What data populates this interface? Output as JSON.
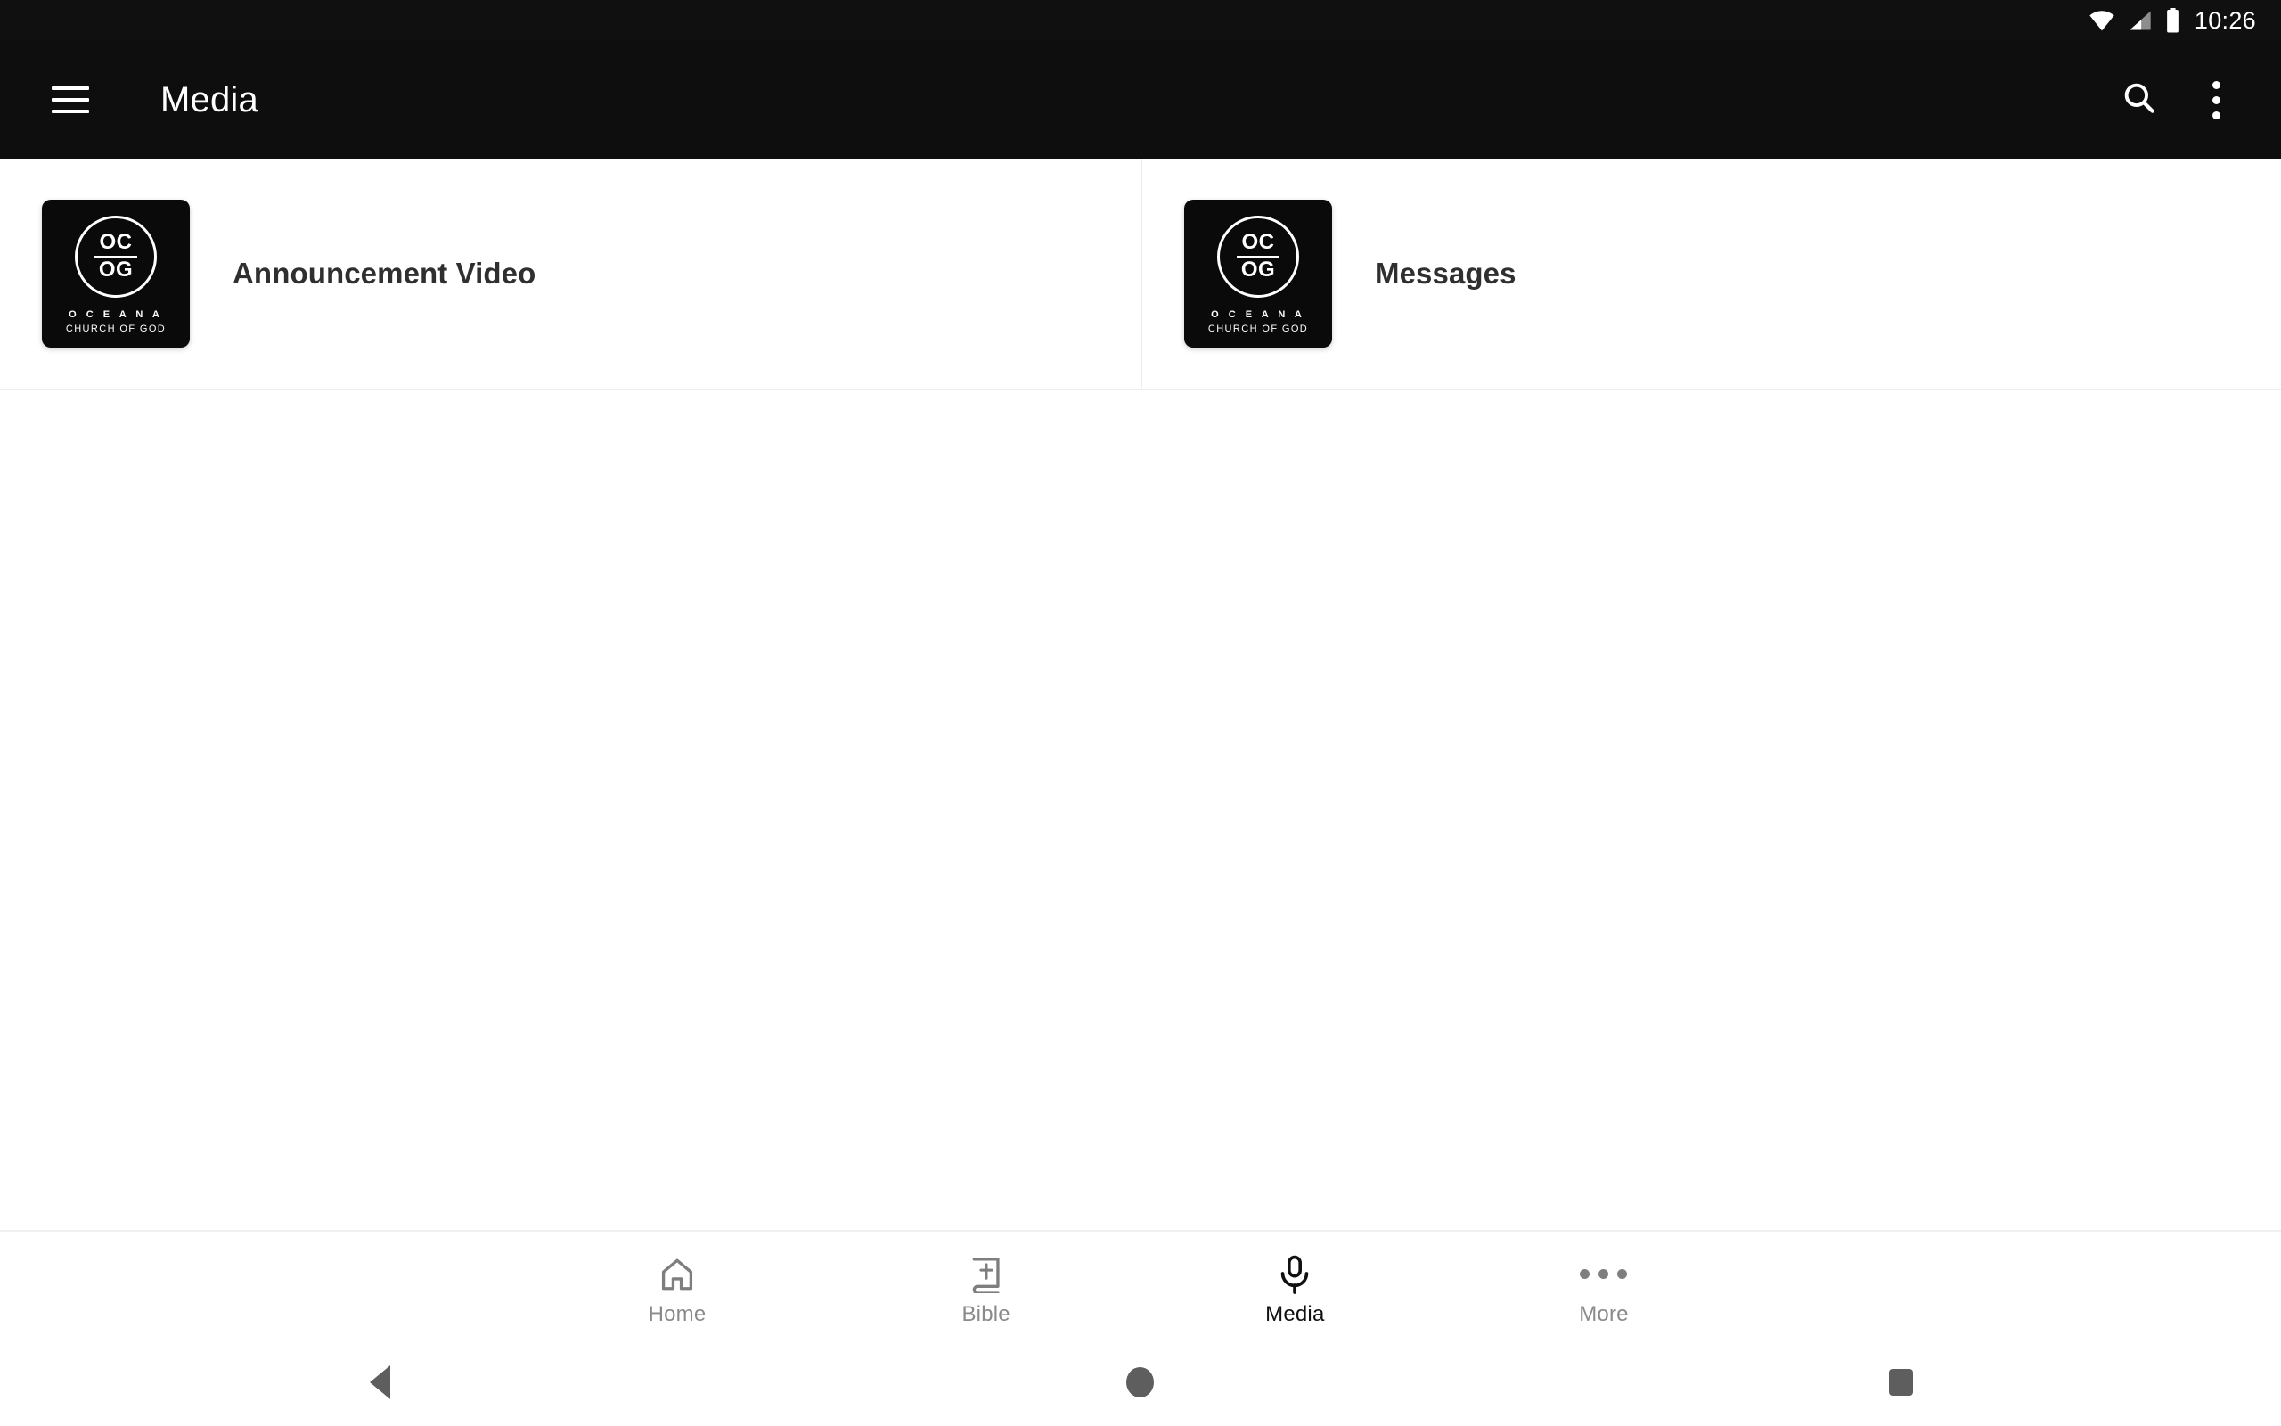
{
  "status_bar": {
    "time": "10:26",
    "icons": [
      "wifi-icon",
      "cell-signal-icon",
      "battery-icon"
    ],
    "background": "#101010"
  },
  "app_bar": {
    "menu_icon": "hamburger-menu-icon",
    "title": "Media",
    "search_icon": "search-icon",
    "overflow_icon": "overflow-menu-icon",
    "background": "#0e0e0e",
    "text_color": "#ffffff"
  },
  "logo": {
    "line1": "OC",
    "line2": "OG",
    "name": "O C E A N A",
    "subtitle": "CHURCH OF GOD",
    "background": "#0a0a0a",
    "foreground": "#ffffff"
  },
  "main": {
    "items": [
      {
        "title": "Announcement Video",
        "thumbnail": "ocog-logo-thumbnail"
      },
      {
        "title": "Messages",
        "thumbnail": "ocog-logo-thumbnail"
      }
    ],
    "title_color": "#2f2f2f",
    "divider_color": "#ececec"
  },
  "bottom_nav": {
    "active_index": 2,
    "inactive_color": "#8a8a8a",
    "active_color": "#111111",
    "tabs": [
      {
        "label": "Home",
        "icon": "home-icon"
      },
      {
        "label": "Bible",
        "icon": "bible-book-icon"
      },
      {
        "label": "Media",
        "icon": "microphone-icon"
      },
      {
        "label": "More",
        "icon": "more-horizontal-icon"
      }
    ]
  },
  "system_nav": {
    "buttons": [
      {
        "name": "back-button",
        "icon": "triangle-back-icon"
      },
      {
        "name": "home-button",
        "icon": "circle-home-icon"
      },
      {
        "name": "recents-button",
        "icon": "square-recents-icon"
      }
    ],
    "color": "#5e5e5e",
    "background": "#ffffff"
  }
}
